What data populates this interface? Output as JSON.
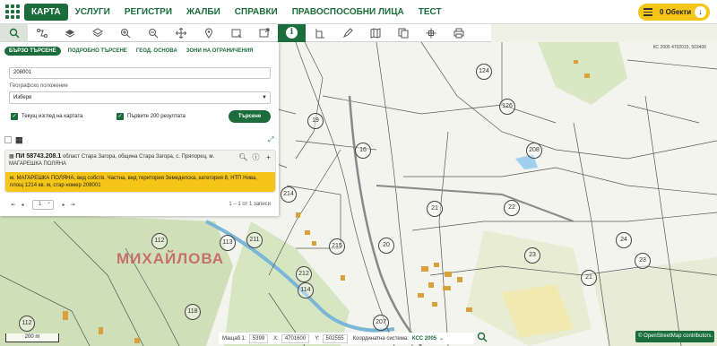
{
  "topnav": {
    "items": [
      {
        "label": "КАРТА",
        "active": true
      },
      {
        "label": "УСЛУГИ"
      },
      {
        "label": "РЕГИСТРИ"
      },
      {
        "label": "ЖАЛБИ"
      },
      {
        "label": "СПРАВКИ"
      },
      {
        "label": "ПРАВОСПОСОБНИ ЛИЦА"
      },
      {
        "label": "ТЕСТ"
      }
    ],
    "objects_label": "0 Обекти"
  },
  "toolbar": {
    "icons": [
      "search-icon",
      "route-icon",
      "layers-icon",
      "stack-icon",
      "zoom-in-icon",
      "zoom-out-icon",
      "pan-icon",
      "location-pin-icon",
      "select-rectangle-icon",
      "share-icon",
      "info-icon",
      "measure-icon",
      "draw-icon",
      "map-icon",
      "pages-icon",
      "crosshair-icon",
      "print-icon"
    ]
  },
  "search_panel": {
    "tabs": [
      "БЪРЗО ТЪРСЕНЕ",
      "ПОДРОБНО ТЪРСЕНЕ",
      "ГЕОД. ОСНОВА",
      "ЗОНИ НА ОГРАНИЧЕНИЯ"
    ],
    "query_value": "208001",
    "geo_label": "Географско положение",
    "geo_select": "Избери",
    "check_current_view": "Текущ изглед на картата",
    "check_first_200": "Първите 200 резултата",
    "search_button": "Търсене"
  },
  "result": {
    "id": "ПИ 58743.208.1",
    "location": "област Стара Загора, община Стара Загора, с. Пряпорец, м. МАГАРЕШКА ПОЛЯНА",
    "description": "м. МАГАРЕШКА ПОЛЯНА, вид собств. Частна, вид територия Земеделска, категория 8, НТП Нива, площ 1214 кв. м, стар номер 208001"
  },
  "pager": {
    "page": "1",
    "info": "1 – 1 от 1 записи"
  },
  "map": {
    "crs_corner": "КС 2005 4702015, 503406",
    "place_name": "МИХАЙЛОВА",
    "parcels": [
      "124",
      "126",
      "19",
      "208",
      "16",
      "21",
      "22",
      "214",
      "215",
      "20",
      "211",
      "24",
      "23",
      "212",
      "23",
      "21",
      "113",
      "114",
      "112",
      "207",
      "112",
      "118"
    ]
  },
  "statusbar": {
    "scale_label": "Мащаб 1:",
    "scale_value": "5399",
    "x_label": "X:",
    "x_value": "4701600",
    "y_label": "Y:",
    "y_value": "502555",
    "crs_label": "Координатна система:",
    "crs_value": "КСС 2005"
  },
  "scalebar": "200 m",
  "attribution": "© OpenStreetMap contributors."
}
